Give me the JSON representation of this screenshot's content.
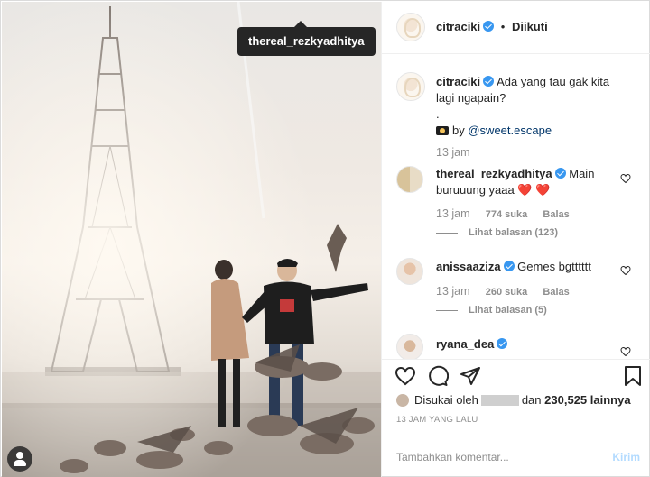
{
  "photo": {
    "tag_label": "thereal_rezkyadhitya"
  },
  "header": {
    "username": "citraciki",
    "separator": "•",
    "follow_label": "Diikuti"
  },
  "caption": {
    "username": "citraciki",
    "text": "Ada yang tau gak kita lagi ngapain?",
    "dot": ".",
    "credit_prefix": "by",
    "credit_link": "@sweet.escape",
    "time": "13 jam"
  },
  "comments": [
    {
      "username": "thereal_rezkyadhitya",
      "text": "Main buruuung yaaa",
      "emoji": "❤️ ❤️",
      "time": "13 jam",
      "likes": "774 suka",
      "reply_label": "Balas",
      "view_replies": "Lihat balasan (123)"
    },
    {
      "username": "anissaaziza",
      "text": "Gemes bgtttttt",
      "time": "13 jam",
      "likes": "260 suka",
      "reply_label": "Balas",
      "view_replies": "Lihat balasan (5)"
    },
    {
      "username": "ryana_dea"
    }
  ],
  "likes": {
    "prefix": "Disukai oleh",
    "middle": "dan",
    "count": "230,525 lainnya"
  },
  "timestamp": "13 JAM YANG LALU",
  "add_comment": {
    "placeholder": "Tambahkan komentar...",
    "post_label": "Kirim"
  },
  "icons": {
    "like": "heart-icon",
    "comment": "comment-icon",
    "share": "share-icon",
    "save": "bookmark-icon",
    "verified": "verified-badge-icon",
    "user_tag": "user-tag-icon"
  },
  "colors": {
    "verified": "#3897f0",
    "heart_red": "#ed4956",
    "post_disabled": "#b3dbff",
    "muted_text": "#8e8e8e"
  }
}
